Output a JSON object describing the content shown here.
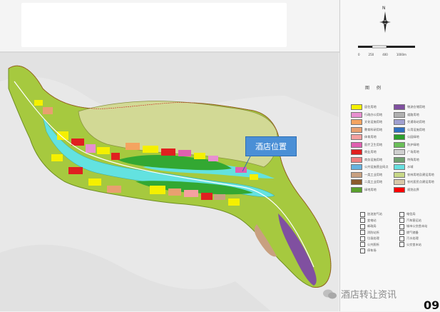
{
  "callout": {
    "label": "酒店位置"
  },
  "scale": {
    "labels": [
      "0",
      "250",
      "400",
      "1000m"
    ]
  },
  "compass": {
    "north": "N"
  },
  "legend": {
    "title": "图  例",
    "left": [
      {
        "label": "居住用地",
        "color": "#f5f000"
      },
      {
        "label": "行政办公用地",
        "color": "#e88fd0"
      },
      {
        "label": "文化设施用地",
        "color": "#f4a460"
      },
      {
        "label": "教育科研用地",
        "color": "#e8a070"
      },
      {
        "label": "体育用地",
        "color": "#f4a0a0"
      },
      {
        "label": "医疗卫生用地",
        "color": "#e060b0"
      },
      {
        "label": "商业用地",
        "color": "#e02020"
      },
      {
        "label": "商务设施用地",
        "color": "#f08080"
      },
      {
        "label": "公共设施营业网点",
        "color": "#66b3e0"
      },
      {
        "label": "一类工业用地",
        "color": "#c8a080"
      },
      {
        "label": "二类工业用地",
        "color": "#8b5a2b"
      },
      {
        "label": "绿地用地",
        "color": "#5aa02c"
      }
    ],
    "right": [
      {
        "label": "物流仓储用地",
        "color": "#8050a0"
      },
      {
        "label": "道路用地",
        "color": "#b0b0b0"
      },
      {
        "label": "交通场站用地",
        "color": "#a0a0d0"
      },
      {
        "label": "公用设施用地",
        "color": "#3070c0"
      },
      {
        "label": "公园绿地",
        "color": "#2ca02c"
      },
      {
        "label": "防护绿地",
        "color": "#6bbf59"
      },
      {
        "label": "广场用地",
        "color": "#d0d0d0"
      },
      {
        "label": "特殊用地",
        "color": "#70a070"
      },
      {
        "label": "水域",
        "color": "#66e0e0"
      },
      {
        "label": "农林用地及建设用地",
        "color": "#c8d888"
      },
      {
        "label": "农村居民点建设用地",
        "color": "#d8c8a8"
      },
      {
        "label": "规划边界",
        "color": "#ff0000"
      }
    ]
  },
  "icons": {
    "left": [
      "加油加气站",
      "变电站",
      "邮政局",
      "消防站所",
      "垃圾处理",
      "公共厕所",
      "停车场"
    ],
    "right": [
      "电信局",
      "汽车客运站",
      "城市公交首末站",
      "燃气储备",
      "污水处理",
      "公交首末站"
    ]
  },
  "watermark": {
    "text": "酒店转让资讯"
  },
  "page": {
    "number": "09"
  }
}
